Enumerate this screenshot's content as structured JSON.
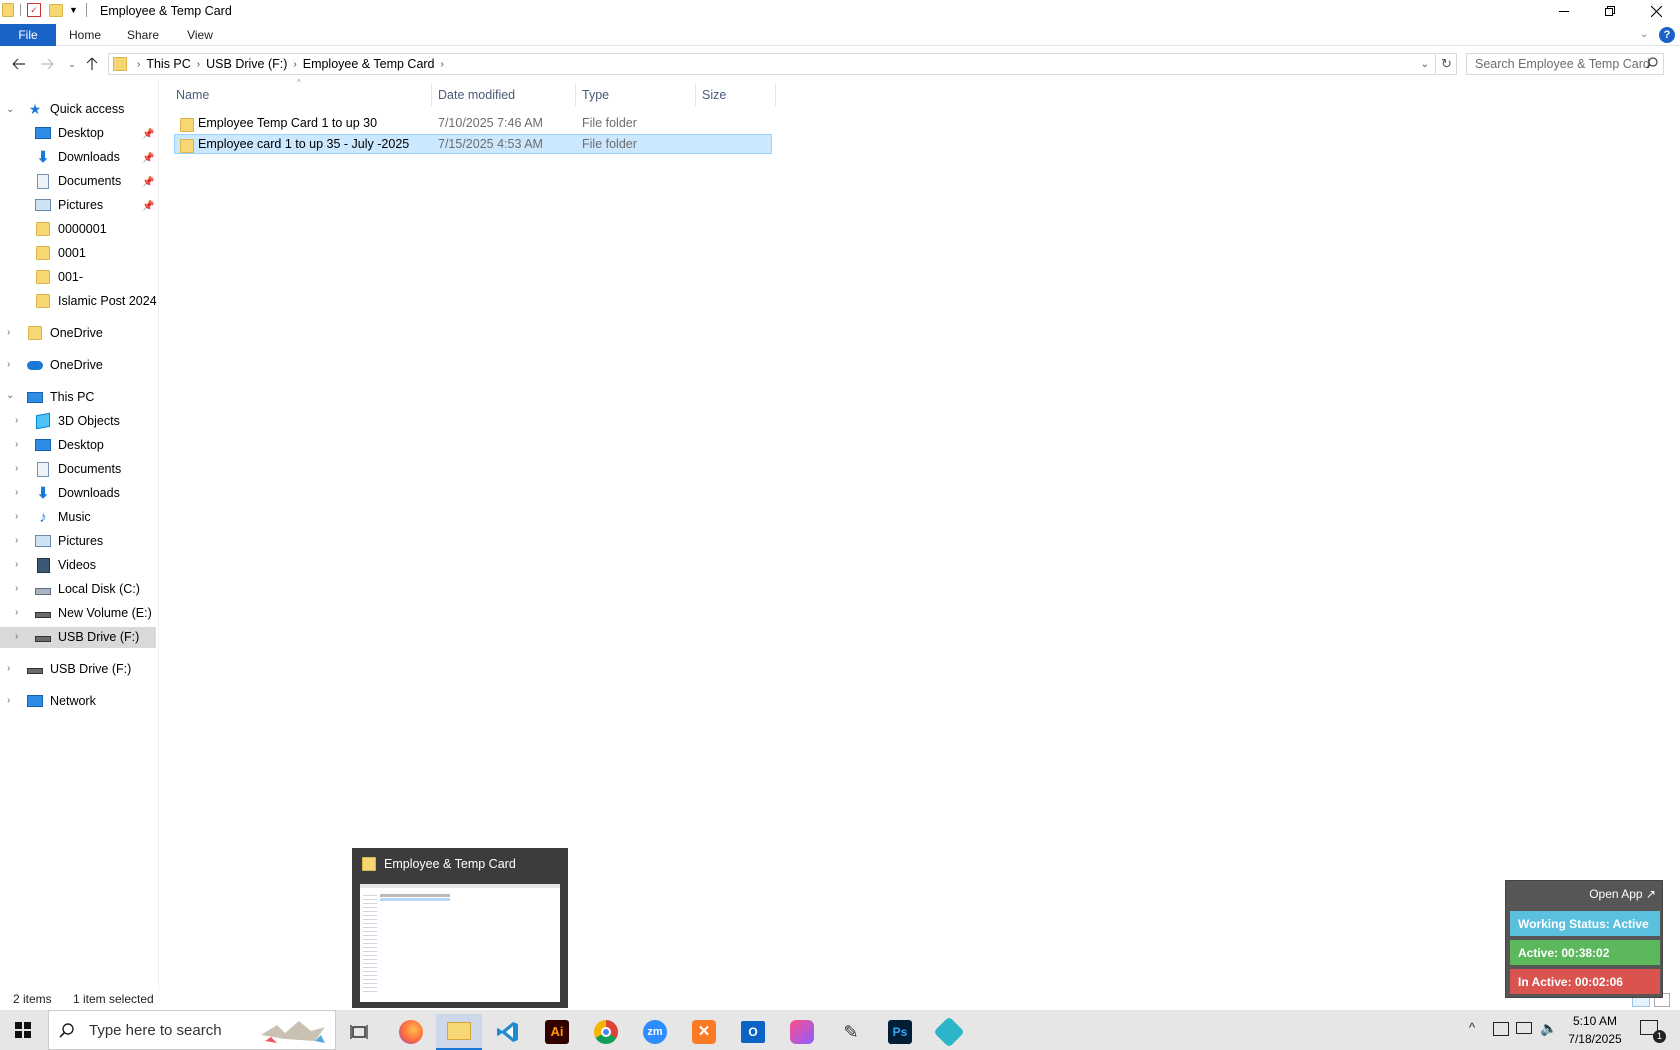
{
  "window": {
    "title": "Employee & Temp Card",
    "controls": [
      "minimize",
      "restore",
      "close"
    ]
  },
  "ribbon": {
    "tabs": [
      "File",
      "Home",
      "Share",
      "View"
    ],
    "help_icon": "?"
  },
  "address": {
    "crumbs": [
      "This PC",
      "USB Drive (F:)",
      "Employee & Temp Card"
    ],
    "search_placeholder": "Search Employee & Temp Card"
  },
  "nav": {
    "quick_access": "Quick access",
    "quick_items": [
      {
        "label": "Desktop",
        "icon": "desktop-icon",
        "pinned": true
      },
      {
        "label": "Downloads",
        "icon": "download-icon",
        "pinned": true
      },
      {
        "label": "Documents",
        "icon": "document-icon",
        "pinned": true
      },
      {
        "label": "Pictures",
        "icon": "picture-icon",
        "pinned": true
      },
      {
        "label": "0000001",
        "icon": "folder-icon",
        "pinned": false
      },
      {
        "label": "0001",
        "icon": "folder-icon",
        "pinned": false
      },
      {
        "label": "001-",
        "icon": "folder-icon",
        "pinned": false
      },
      {
        "label": "Islamic Post 2024",
        "icon": "folder-icon",
        "pinned": false
      }
    ],
    "onedrive_1": "OneDrive",
    "onedrive_2": "OneDrive",
    "this_pc": "This PC",
    "pc_items": [
      {
        "label": "3D Objects",
        "icon": "3d-objects-icon"
      },
      {
        "label": "Desktop",
        "icon": "desktop-icon"
      },
      {
        "label": "Documents",
        "icon": "document-icon"
      },
      {
        "label": "Downloads",
        "icon": "download-icon"
      },
      {
        "label": "Music",
        "icon": "music-icon"
      },
      {
        "label": "Pictures",
        "icon": "picture-icon"
      },
      {
        "label": "Videos",
        "icon": "video-icon"
      },
      {
        "label": "Local Disk (C:)",
        "icon": "disk-icon"
      },
      {
        "label": "New Volume (E:)",
        "icon": "drive-icon"
      },
      {
        "label": "USB Drive (F:)",
        "icon": "drive-icon"
      }
    ],
    "usb_drive": "USB Drive (F:)",
    "network": "Network"
  },
  "files": {
    "columns": [
      "Name",
      "Date modified",
      "Type",
      "Size"
    ],
    "rows": [
      {
        "name": "Employee Temp Card 1 to up 30",
        "date": "7/10/2025 7:46 AM",
        "type": "File folder",
        "size": ""
      },
      {
        "name": "Employee card 1 to up 35 - July -2025",
        "date": "7/15/2025 4:53 AM",
        "type": "File folder",
        "size": ""
      }
    ]
  },
  "status": {
    "items": "2 items",
    "selected": "1 item selected"
  },
  "taskbar": {
    "search_placeholder": "Type here to search",
    "time": "5:10 AM",
    "date": "7/18/2025",
    "notification_count": "1"
  },
  "preview": {
    "title": "Employee & Temp Card"
  },
  "widget": {
    "open_app": "Open App ↗",
    "working_status": "Working Status: Active",
    "active": "Active: 00:38:02",
    "inactive": "In Active: 00:02:06",
    "colors": {
      "status": "#5bc0de",
      "active": "#5cb85c",
      "inactive": "#d9534f"
    }
  }
}
